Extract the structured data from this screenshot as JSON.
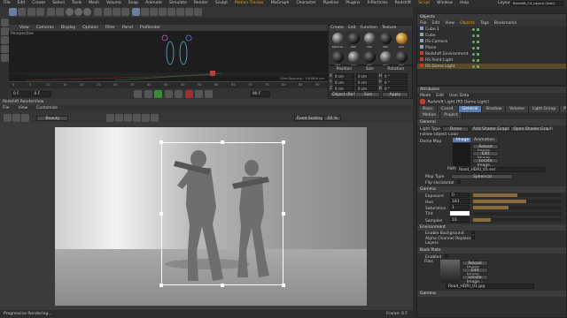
{
  "app": {
    "menu": [
      "File",
      "Edit",
      "Create",
      "Select",
      "Tools",
      "Mesh",
      "Volume",
      "Snap",
      "Animate",
      "Simulate",
      "Render",
      "Sculpt",
      "Motion Tracker",
      "MoGraph",
      "Character",
      "Pipeline",
      "Plugins",
      "X-Particles",
      "Redshift",
      "Script",
      "Window",
      "Help"
    ],
    "layout_label": "Layout:",
    "layout_value": "Redshift_C4_Layout (User)"
  },
  "viewport": {
    "menu": [
      "View",
      "Cameras",
      "Display",
      "Options",
      "Filter",
      "Panel",
      "ProRender"
    ],
    "label": "Perspective",
    "grid_spacing": "Grid Spacing : 100000 cm"
  },
  "timeline": {
    "start": "0 F",
    "end": "90 F",
    "current": "0 F",
    "ticks": [
      "0",
      "5",
      "10",
      "15",
      "20",
      "25",
      "30",
      "35",
      "40",
      "45",
      "50",
      "55",
      "60",
      "65",
      "70",
      "75",
      "80",
      "85",
      "90"
    ]
  },
  "materials": {
    "menu": [
      "Create",
      "Edit",
      "Function",
      "Texture"
    ],
    "names": [
      "Material",
      "Mat",
      "Mat",
      "Mat",
      "Mat",
      "Mat",
      "Mat",
      "Mat",
      "Mat",
      "Mat"
    ]
  },
  "coords": {
    "headers": [
      "Position",
      "Size",
      "Rotation"
    ],
    "rows": [
      {
        "axis": "X",
        "pos": "0 cm",
        "size": "0 cm",
        "rot_label": "H",
        "rot": "0 °"
      },
      {
        "axis": "Y",
        "pos": "0 cm",
        "size": "0 cm",
        "rot_label": "P",
        "rot": "0 °"
      },
      {
        "axis": "Z",
        "pos": "0 cm",
        "size": "0 cm",
        "rot_label": "B",
        "rot": "0 °"
      }
    ],
    "mode": "Object (Rel)",
    "size_mode": "Size",
    "apply": "Apply"
  },
  "objects": {
    "title": "Objects",
    "menu": [
      "File",
      "Edit",
      "View",
      "Objects",
      "Tags",
      "Bookmarks"
    ],
    "items": [
      "Cube.1",
      "Cube",
      "RS Camera",
      "Plane",
      "Redshift Environment",
      "RS Point Light",
      "RS Dome Light"
    ]
  },
  "render_view": {
    "title": "Redshift RenderView",
    "menu": [
      "File",
      "View",
      "Customize"
    ],
    "mode": "Beauty",
    "zoom": "50 %",
    "fit": "Fixed Scaling",
    "status_left": "Progressive Rendering...",
    "status_right": "Frame: 0 F"
  },
  "attributes": {
    "title": "Attributes",
    "menu": [
      "Mode",
      "Edit",
      "User Data"
    ],
    "object_name": "Redshift Light [RS Dome Light]",
    "tabs_row1": [
      "Basic",
      "Coord.",
      "General",
      "Shadow",
      "Volume",
      "Light Group",
      "Photon"
    ],
    "tabs_row2": [
      "Motion",
      "Project"
    ],
    "active_tab": "General",
    "general": {
      "header": "General",
      "light_type_label": "Light Type",
      "light_type": "Dome",
      "add_shader": "Add Shader Graph",
      "open_shader": "Open Shader Graph",
      "follow": "Follow Object Color",
      "dome_map_label": "Dome Map",
      "dome_tabs": [
        "Image",
        "Animation"
      ],
      "img_buttons": [
        "Reload Image...",
        "Edit Image...",
        "Locate Image..."
      ],
      "path_label": "Path",
      "path": "Road_HDRI_01.exr",
      "map_type_label": "Map Type",
      "map_type": "Spherical",
      "flip_label": "Flip Horizontal"
    },
    "gamma": {
      "header": "Gamma",
      "rows": [
        {
          "label": "Exposure",
          "value": "0"
        },
        {
          "label": "Hue",
          "value": "181"
        },
        {
          "label": "Saturation",
          "value": "1"
        },
        {
          "label": "Tint",
          "value": ""
        },
        {
          "label": "Samples",
          "value": "16"
        }
      ]
    },
    "environment": {
      "header": "Environment",
      "rows": [
        "Enable Background",
        "Alpha Channel Replace",
        "Layers"
      ]
    },
    "backplate": {
      "header": "Back Plate",
      "enabled_label": "Enabled",
      "files_label": "Files",
      "buttons": [
        "Reload Image...",
        "Edit Image...",
        "Locate Image..."
      ],
      "path": "Road_HDRI_01.jpg"
    },
    "gamma2": {
      "header": "Gamma"
    }
  },
  "colors": {
    "accent": "#e8a000",
    "selection": "#5a7ab0"
  }
}
